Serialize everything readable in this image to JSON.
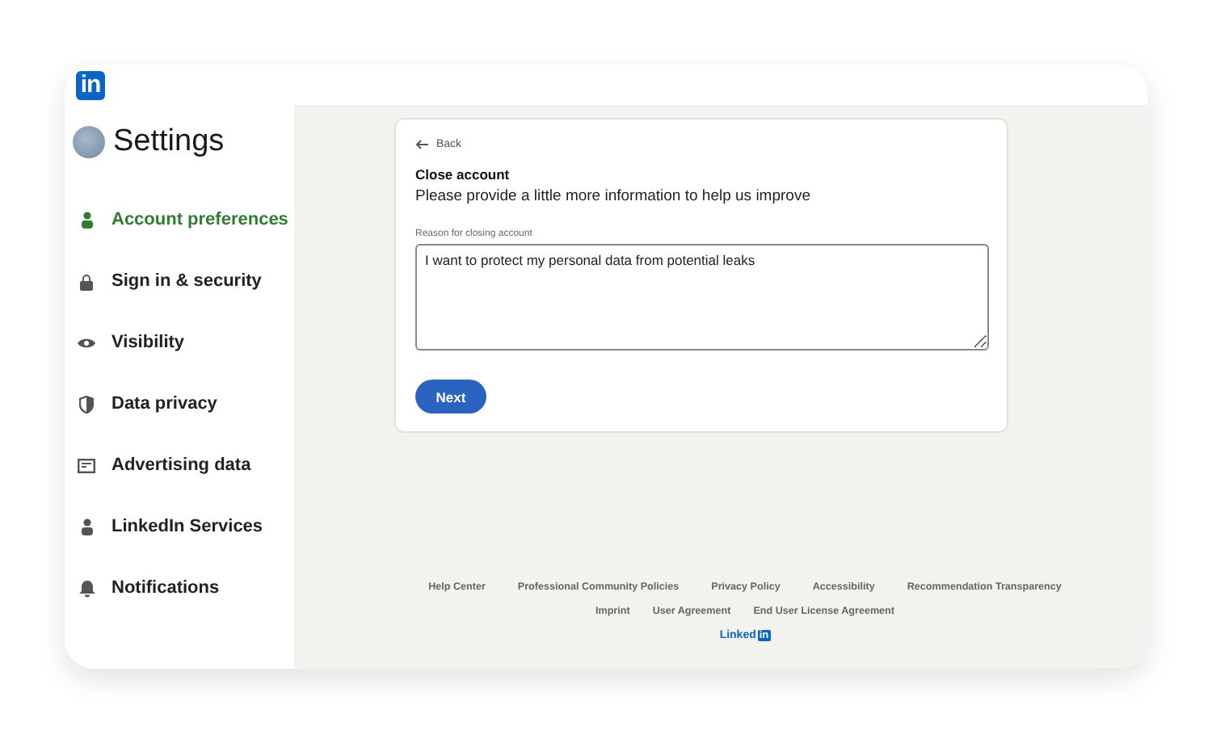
{
  "header": {
    "logo": "in"
  },
  "sidebar": {
    "title": "Settings",
    "items": [
      {
        "label": "Account preferences",
        "kind": "person",
        "selected": true
      },
      {
        "label": "Sign in & security",
        "kind": "lock",
        "selected": false
      },
      {
        "label": "Visibility",
        "kind": "eye",
        "selected": false
      },
      {
        "label": "Data privacy",
        "kind": "shield",
        "selected": false
      },
      {
        "label": "Advertising data",
        "kind": "ad",
        "selected": false
      },
      {
        "label": "LinkedIn Services",
        "kind": "person",
        "selected": false
      },
      {
        "label": "Notifications",
        "kind": "bell",
        "selected": false
      }
    ]
  },
  "card": {
    "back": "Back",
    "title": "Close account",
    "subtitle": "Please provide a little more information to help us improve",
    "field_label": "Reason for closing account",
    "field_value": "I want to protect my personal data from potential leaks",
    "button": "Next"
  },
  "footer": {
    "links_row_1": [
      "Help Center",
      "Professional Community Policies",
      "Privacy Policy",
      "Accessibility",
      "Recommendation Transparency"
    ],
    "links_row_2": [
      "Imprint",
      "User Agreement",
      "End User License Agreement"
    ],
    "logo_word": "Linked",
    "logo_badge": "in"
  }
}
